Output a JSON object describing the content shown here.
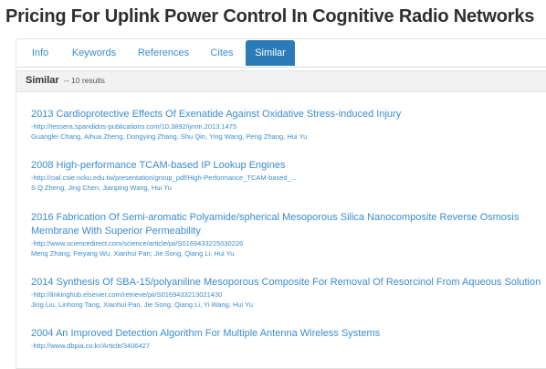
{
  "page": {
    "title": "Pricing For Uplink Power Control In Cognitive Radio Networks"
  },
  "tabs": [
    {
      "label": "Info",
      "active": false
    },
    {
      "label": "Keywords",
      "active": false
    },
    {
      "label": "References",
      "active": false
    },
    {
      "label": "Cites",
      "active": false
    },
    {
      "label": "Similar",
      "active": true
    }
  ],
  "section": {
    "label": "Similar",
    "count": "-- 10 results"
  },
  "colors": {
    "accent": "#2b7bb9",
    "link": "#3b8ccd"
  },
  "results": [
    {
      "year": "2013",
      "title": "Cardioprotective Effects Of Exenatide Against Oxidative Stress-induced Injury",
      "url": "-http://tessera.spandidos-publications.com/10.3892/ijmm.2013.1475",
      "authors": "Guanglei Chang, Aihua Zheng, Dongying Zhang, Shu Qin, Ying Wang, Peng Zhang, Hui Yu"
    },
    {
      "year": "2008",
      "title": "High-performance TCAM-based IP Lookup Engines",
      "url": "-http://cial.csie.ncku.edu.tw/presentation/group_pdf/High-Performance_TCAM-based_...",
      "authors": "S Q Zheng, Jing Chen, Jianping Wang, Hui Yu"
    },
    {
      "year": "2016",
      "title": "Fabrication Of Semi-aromatic Polyamide/spherical Mesoporous Silica Nanocomposite Reverse Osmosis Membrane With Superior Permeability",
      "url": "-http://www.sciencedirect.com/science/article/pii/S0169433215030226",
      "authors": "Meng Zhang, Feiyang Wu, Xianhui Pan; Jie Song, Qiang Li, Hui Yu"
    },
    {
      "year": "2014",
      "title": "Synthesis Of SBA-15/polyaniline Mesoporous Composite For Removal Of Resorcinol From Aqueous Solution",
      "url": "-http://linkinghub.elsevier.com/retrieve/pii/S0169433213021430",
      "authors": "Jing Liu, Linhong Tang, Xianhui Pan, Jie Song, Qiang Li, Yi Wang, Hui Yu"
    },
    {
      "year": "2004",
      "title": "An Improved Detection Algorithm For Multiple Antenna Wireless Systems",
      "url": "-http://www.dbpia.co.kr/Article/3406427",
      "authors": ""
    }
  ]
}
